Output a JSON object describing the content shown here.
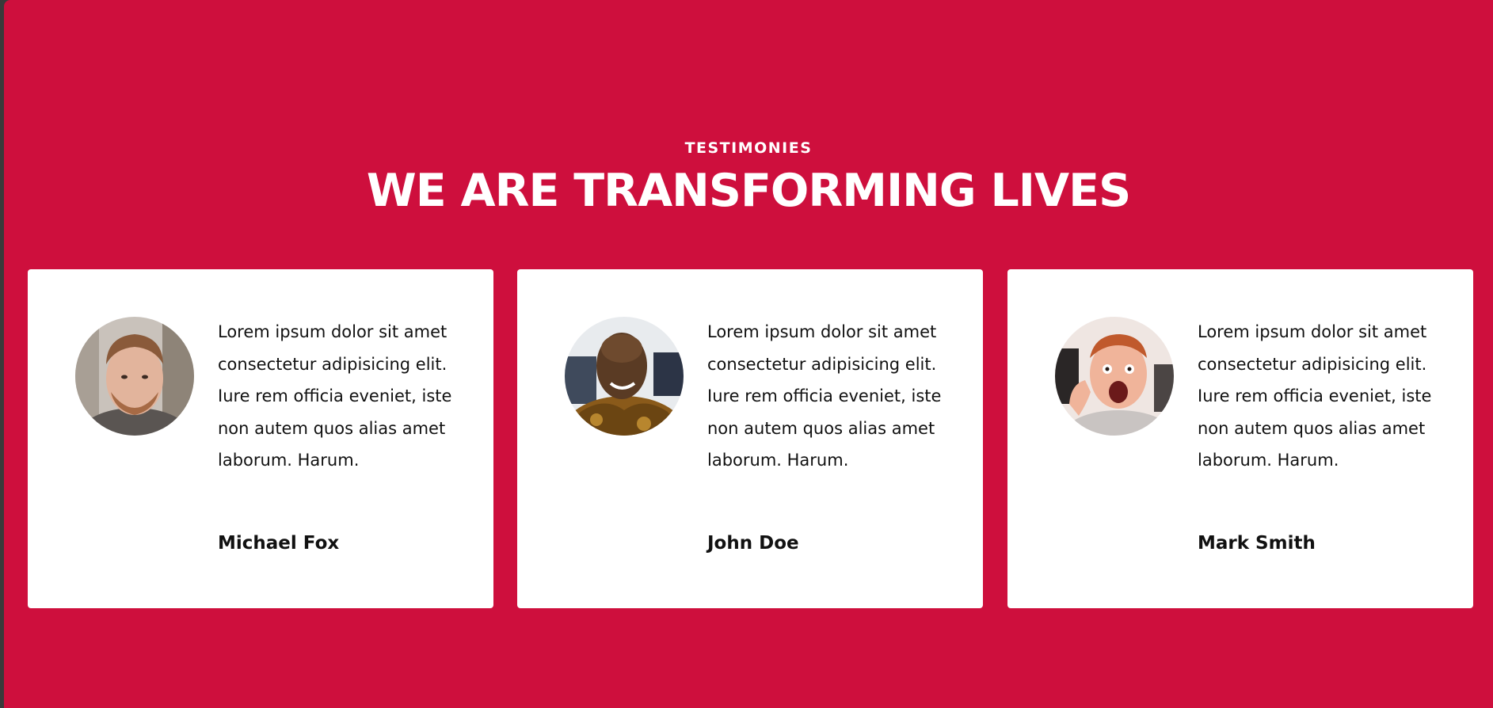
{
  "section": {
    "kicker": "TESTIMONIES",
    "title": "WE ARE TRANSFORMING LIVES",
    "background_color": "#ce0f3d"
  },
  "testimonials": [
    {
      "quote": "Lorem ipsum dolor sit amet consectetur adipisicing elit. Iure rem officia eveniet, iste non autem quos alias amet laborum. Harum.",
      "name": "Michael Fox",
      "avatar_icon": "avatar-photo"
    },
    {
      "quote": "Lorem ipsum dolor sit amet consectetur adipisicing elit. Iure rem officia eveniet, iste non autem quos alias amet laborum. Harum.",
      "name": "John Doe",
      "avatar_icon": "avatar-photo"
    },
    {
      "quote": "Lorem ipsum dolor sit amet consectetur adipisicing elit. Iure rem officia eveniet, iste non autem quos alias amet laborum. Harum.",
      "name": "Mark Smith",
      "avatar_icon": "avatar-photo"
    }
  ]
}
